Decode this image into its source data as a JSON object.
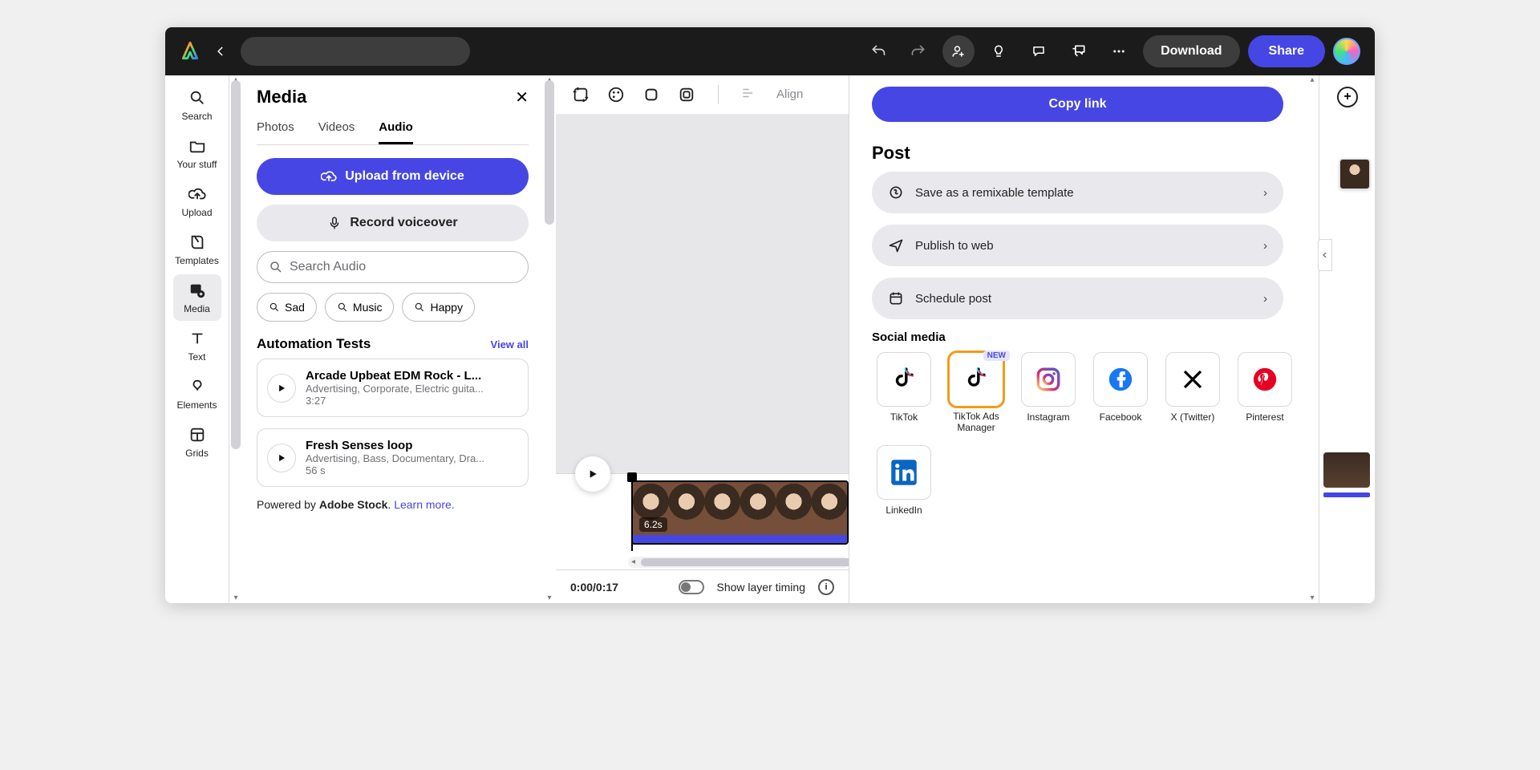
{
  "topbar": {
    "download": "Download",
    "share": "Share"
  },
  "rail": [
    {
      "label": "Search"
    },
    {
      "label": "Your stuff"
    },
    {
      "label": "Upload"
    },
    {
      "label": "Templates"
    },
    {
      "label": "Media"
    },
    {
      "label": "Text"
    },
    {
      "label": "Elements"
    },
    {
      "label": "Grids"
    }
  ],
  "media": {
    "title": "Media",
    "tabs": [
      "Photos",
      "Videos",
      "Audio"
    ],
    "active_tab": "Audio",
    "upload_label": "Upload from device",
    "record_label": "Record voiceover",
    "search_placeholder": "Search Audio",
    "chips": [
      "Sad",
      "Music",
      "Happy"
    ],
    "section_title": "Automation Tests",
    "view_all": "View all",
    "tracks": [
      {
        "title": "Arcade Upbeat EDM Rock - L...",
        "tags": "Advertising, Corporate, Electric guita...",
        "duration": "3:27"
      },
      {
        "title": "Fresh Senses loop",
        "tags": "Advertising, Bass, Documentary, Dra...",
        "duration": "56 s"
      }
    ],
    "powered_prefix": "Powered by ",
    "powered_brand": "Adobe Stock",
    "learn_more": "Learn more."
  },
  "canvas": {
    "align": "Align",
    "clip_duration": "6.2s",
    "time": "0:00/0:17",
    "show_layer_timing": "Show layer timing"
  },
  "sheet": {
    "copy": "Copy link",
    "post": "Post",
    "rows": [
      "Save as a remixable template",
      "Publish to web",
      "Schedule post"
    ],
    "social_title": "Social media",
    "social": [
      {
        "label": "TikTok"
      },
      {
        "label": "TikTok Ads Manager",
        "new": "NEW",
        "highlight": true
      },
      {
        "label": "Instagram"
      },
      {
        "label": "Facebook"
      },
      {
        "label": "X (Twitter)"
      },
      {
        "label": "Pinterest"
      }
    ],
    "social2": [
      {
        "label": "LinkedIn"
      }
    ]
  }
}
